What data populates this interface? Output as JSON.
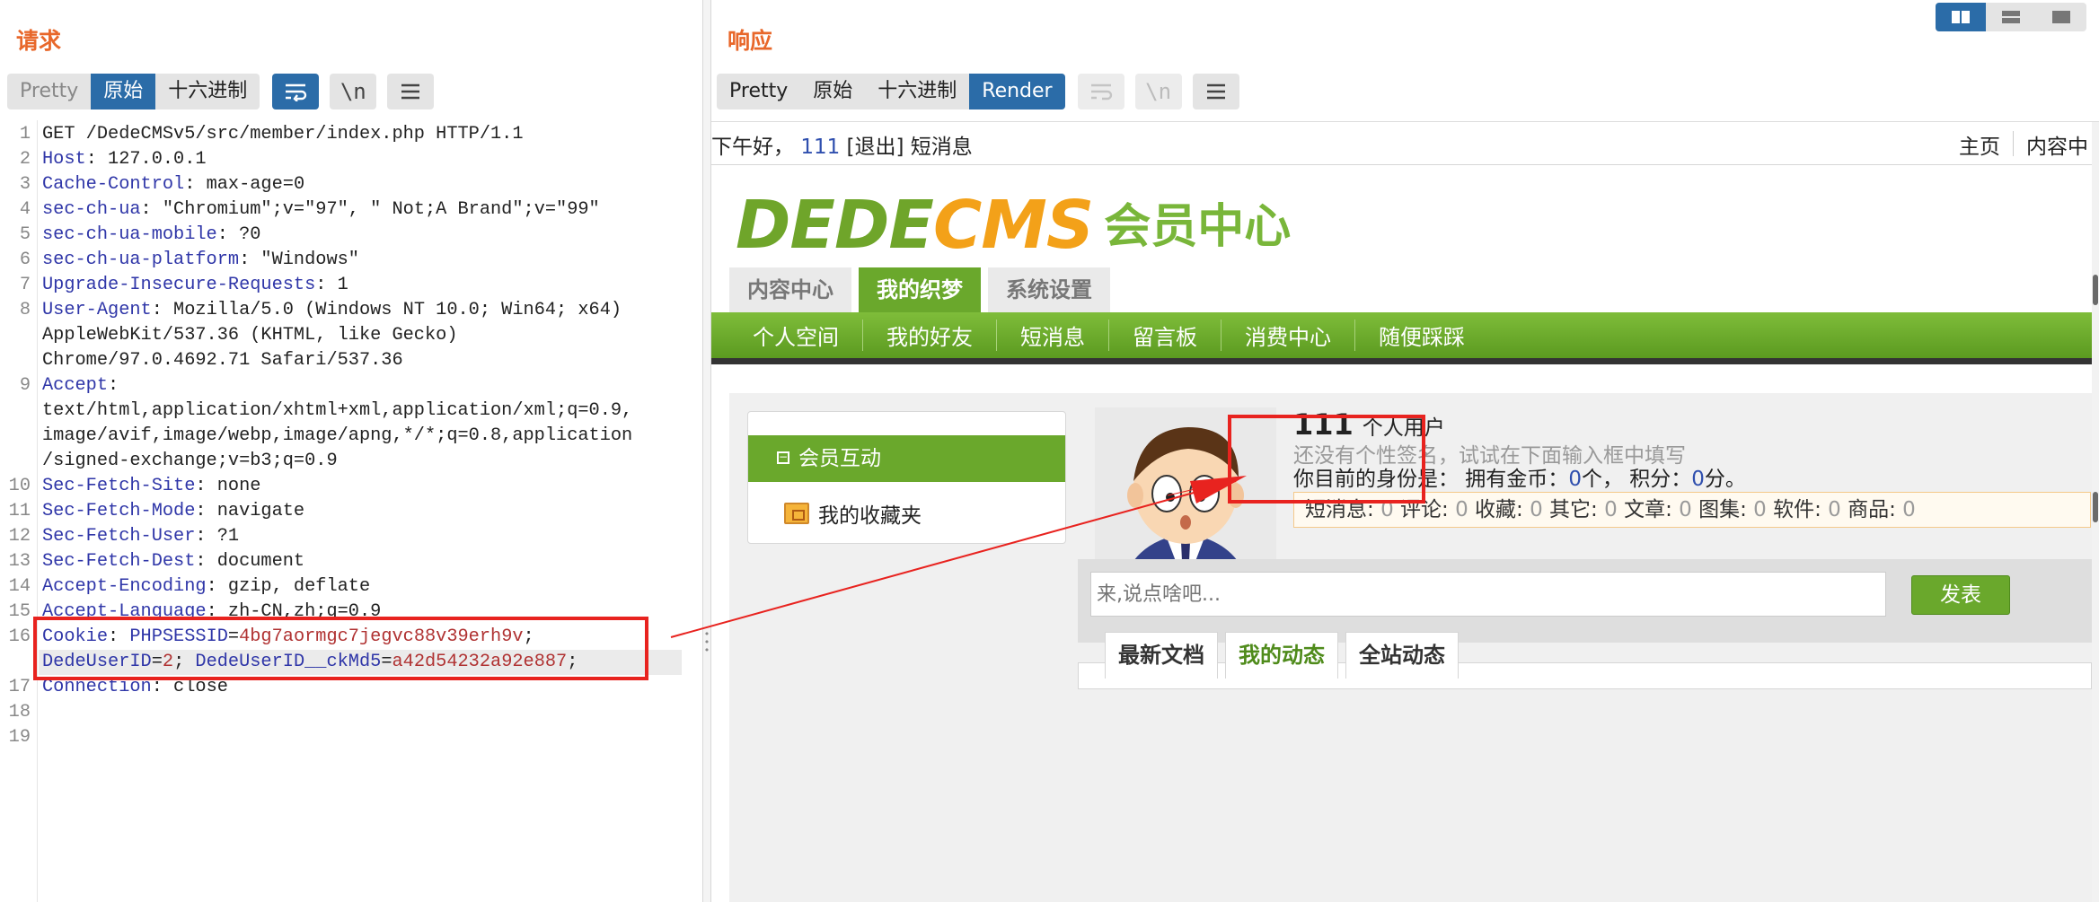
{
  "request": {
    "title": "请求",
    "tabs": [
      {
        "label": "Pretty",
        "state": "dim"
      },
      {
        "label": "原始",
        "state": "active"
      },
      {
        "label": "十六进制",
        "state": "normal"
      }
    ],
    "tools": {
      "wrap_icon": "word-wrap-icon",
      "newline_label": "\\n",
      "menu_icon": "hamburger-menu-icon"
    },
    "lines": [
      {
        "n": "1",
        "k": "",
        "v": "GET /DedeCMSv5/src/member/index.php HTTP/1.1"
      },
      {
        "n": "2",
        "k": "Host",
        "v": ": 127.0.0.1"
      },
      {
        "n": "3",
        "k": "Cache-Control",
        "v": ": max-age=0"
      },
      {
        "n": "4",
        "k": "sec-ch-ua",
        "v": ": \"Chromium\";v=\"97\", \" Not;A Brand\";v=\"99\""
      },
      {
        "n": "5",
        "k": "sec-ch-ua-mobile",
        "v": ": ?0"
      },
      {
        "n": "6",
        "k": "sec-ch-ua-platform",
        "v": ": \"Windows\""
      },
      {
        "n": "7",
        "k": "Upgrade-Insecure-Requests",
        "v": ": 1"
      },
      {
        "n": "8",
        "k": "User-Agent",
        "v": ": Mozilla/5.0 (Windows NT 10.0; Win64; x64)"
      },
      {
        "n": "",
        "k": "",
        "v": "AppleWebKit/537.36 (KHTML, like Gecko)"
      },
      {
        "n": "",
        "k": "",
        "v": "Chrome/97.0.4692.71 Safari/537.36"
      },
      {
        "n": "9",
        "k": "Accept",
        "v": ":"
      },
      {
        "n": "",
        "k": "",
        "v": "text/html,application/xhtml+xml,application/xml;q=0.9,"
      },
      {
        "n": "",
        "k": "",
        "v": "image/avif,image/webp,image/apng,*/*;q=0.8,application"
      },
      {
        "n": "",
        "k": "",
        "v": "/signed-exchange;v=b3;q=0.9"
      },
      {
        "n": "10",
        "k": "Sec-Fetch-Site",
        "v": ": none"
      },
      {
        "n": "11",
        "k": "Sec-Fetch-Mode",
        "v": ": navigate"
      },
      {
        "n": "12",
        "k": "Sec-Fetch-User",
        "v": ": ?1"
      },
      {
        "n": "13",
        "k": "Sec-Fetch-Dest",
        "v": ": document"
      },
      {
        "n": "14",
        "k": "Accept-Encoding",
        "v": ": gzip, deflate"
      },
      {
        "n": "15",
        "k": "Accept-Language",
        "v": ": zh-CN,zh;q=0.9"
      },
      {
        "n": "16",
        "k": "Cookie",
        "v": ": ",
        "cookie": [
          {
            "name": "PHPSESSID",
            "value": "4bg7aormgc7jegvc88v39erh9v",
            "sep": ";"
          }
        ]
      },
      {
        "n": "",
        "k": "",
        "v": "",
        "cookie": [
          {
            "name": "DedeUserID",
            "value": "2",
            "sep": ";"
          },
          {
            "name": " DedeUserID__ckMd5",
            "value": "a42d54232a92e887",
            "sep": ";"
          }
        ]
      },
      {
        "n": "17",
        "k": "Connection",
        "v": ": close"
      },
      {
        "n": "18",
        "k": "",
        "v": ""
      },
      {
        "n": "19",
        "k": "",
        "v": ""
      }
    ]
  },
  "response": {
    "title": "响应",
    "tabs": [
      {
        "label": "Pretty",
        "state": "normal"
      },
      {
        "label": "原始",
        "state": "normal"
      },
      {
        "label": "十六进制",
        "state": "normal"
      },
      {
        "label": "Render",
        "state": "active"
      }
    ],
    "layout_toggle": [
      "split-horizontal-icon",
      "split-vertical-icon",
      "single-pane-icon"
    ],
    "page": {
      "greeting": "下午好，",
      "username": "111",
      "logout": "[退出]",
      "messages": "短消息",
      "top_links": [
        "主页",
        "内容中"
      ],
      "logo_dede": "DEDE",
      "logo_cms": "CMS",
      "logo_cn": "会员中心",
      "main_tabs": [
        {
          "label": "内容中心",
          "active": false
        },
        {
          "label": "我的织梦",
          "active": true
        },
        {
          "label": "系统设置",
          "active": false
        }
      ],
      "subnav": [
        "个人空间",
        "我的好友",
        "短消息",
        "留言板",
        "消费中心",
        "随便踩踩"
      ],
      "side_header": "会员互动",
      "side_item": "我的收藏夹",
      "profile_name": "111",
      "profile_type": "个人用户",
      "signature_hint": "还没有个性签名，试试在下面输入框中填写",
      "identity": {
        "prefix": "你目前的身份是：  拥有金币：",
        "coins": "0",
        "mid": "个，  积分：",
        "points": "0",
        "suffix": "分。"
      },
      "stats": [
        {
          "label": "短消息",
          "value": "0"
        },
        {
          "label": "评论",
          "value": "0"
        },
        {
          "label": "收藏",
          "value": "0"
        },
        {
          "label": "其它",
          "value": "0"
        },
        {
          "label": "文章",
          "value": "0"
        },
        {
          "label": "图集",
          "value": "0"
        },
        {
          "label": "软件",
          "value": "0"
        },
        {
          "label": "商品",
          "value": "0"
        }
      ],
      "post_placeholder": "来,说点啥吧...",
      "post_button": "发表",
      "feed_tabs": [
        {
          "label": "最新文档",
          "active": false
        },
        {
          "label": "我的动态",
          "active": true
        },
        {
          "label": "全站动态",
          "active": false
        }
      ]
    }
  },
  "colors": {
    "title_orange": "#e8672a",
    "burp_blue": "#2b6ca8",
    "dede_green": "#6aa82c",
    "annotation_red": "#e8231f",
    "header_key_blue": "#2f36a8",
    "cookie_value_red": "#b03232"
  }
}
